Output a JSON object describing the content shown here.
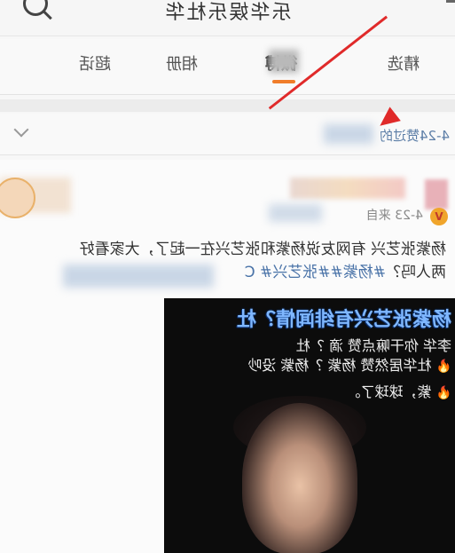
{
  "header": {
    "title": "乐华娱乐杜华"
  },
  "tabs": [
    {
      "label": "精选",
      "active": false
    },
    {
      "label": "微博",
      "active": true
    },
    {
      "label": "相册",
      "active": false
    },
    {
      "label": "超话",
      "active": false
    }
  ],
  "hot": {
    "text": "4-24赞过的"
  },
  "post": {
    "meta": "4-23 来自",
    "text_line1": "杨紫张艺兴 有网友说杨紫和张艺兴在一起了，大家看好",
    "text_line2_prefix": "两人吗？",
    "text_line2_tags": "#杨紫##张艺兴# C",
    "video": {
      "title": "杨紫张艺兴有绯闻情？杜",
      "line1": "李华 你干嘛点赞 滴 ？杜",
      "line2": "杜华居然赞 杨紫 ？杨紫 没吵",
      "line3": "紫，球球了。"
    }
  },
  "colors": {
    "accent": "#f07d2a",
    "link": "#4a73a8",
    "arrow": "#e02a2a"
  }
}
